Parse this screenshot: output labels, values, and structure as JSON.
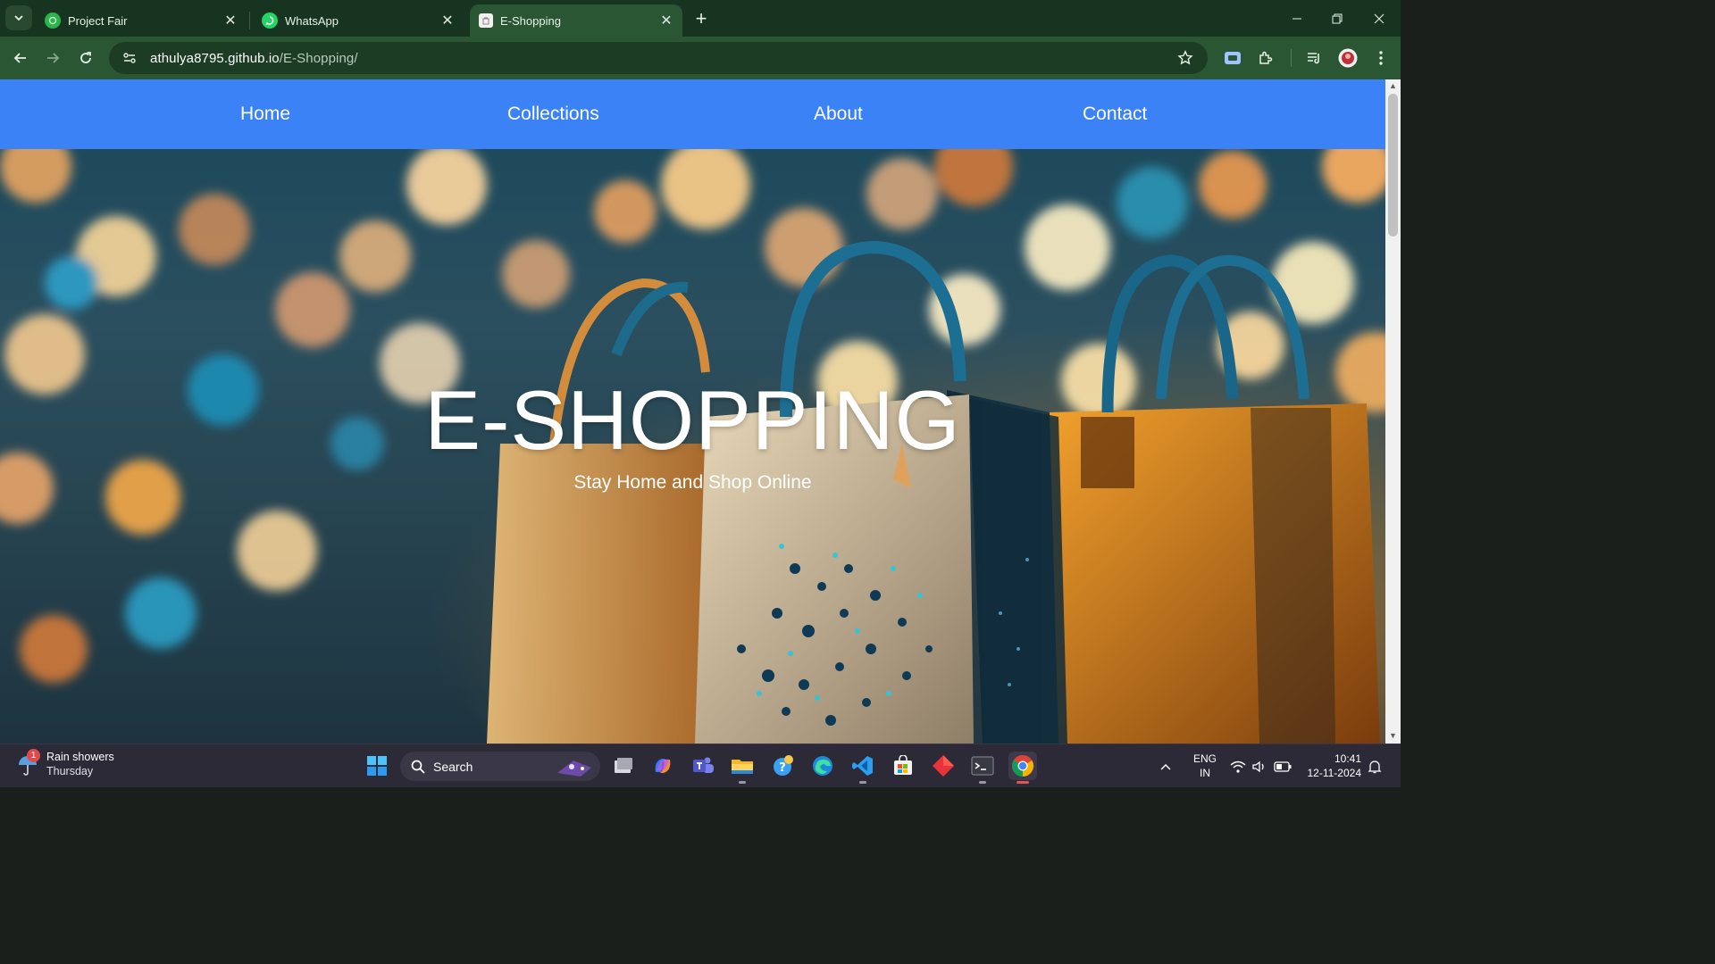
{
  "browser": {
    "tabs": [
      {
        "title": "Project Fair",
        "active": false
      },
      {
        "title": "WhatsApp",
        "active": false
      },
      {
        "title": "E-Shopping",
        "active": true
      }
    ],
    "url_host": "athulya8795.github.io",
    "url_path": "/E-Shopping/"
  },
  "site": {
    "nav": [
      "Home",
      "Collections",
      "About",
      "Contact"
    ],
    "hero_title": "E-SHOPPING",
    "hero_subtitle": "Stay Home and Shop Online"
  },
  "taskbar": {
    "weather_title": "Rain showers",
    "weather_day": "Thursday",
    "weather_badge": "1",
    "search_label": "Search",
    "lang_line1": "ENG",
    "lang_line2": "IN",
    "time": "10:41",
    "date": "12-11-2024"
  },
  "colors": {
    "tabstrip": "#16341f",
    "toolbar": "#2a5633",
    "site_nav": "#3b82f6",
    "taskbar": "#2d2a38"
  },
  "icons": {
    "tabstrip": [
      "tab-search-icon",
      "new-tab-icon",
      "minimize-icon",
      "restore-icon",
      "close-window-icon"
    ],
    "toolbar": [
      "back-icon",
      "forward-icon",
      "reload-icon",
      "site-info-icon",
      "bookmark-star-icon",
      "screen-capture-icon",
      "extensions-icon",
      "media-control-icon",
      "profile-avatar-icon",
      "more-menu-icon"
    ],
    "taskbar_apps": [
      "windows-start-icon",
      "task-view-icon",
      "copilot-icon",
      "teams-icon",
      "file-explorer-icon",
      "help-icon",
      "edge-icon",
      "vscode-icon",
      "ms-store-icon",
      "git-icon",
      "terminal-icon",
      "chrome-icon"
    ]
  }
}
